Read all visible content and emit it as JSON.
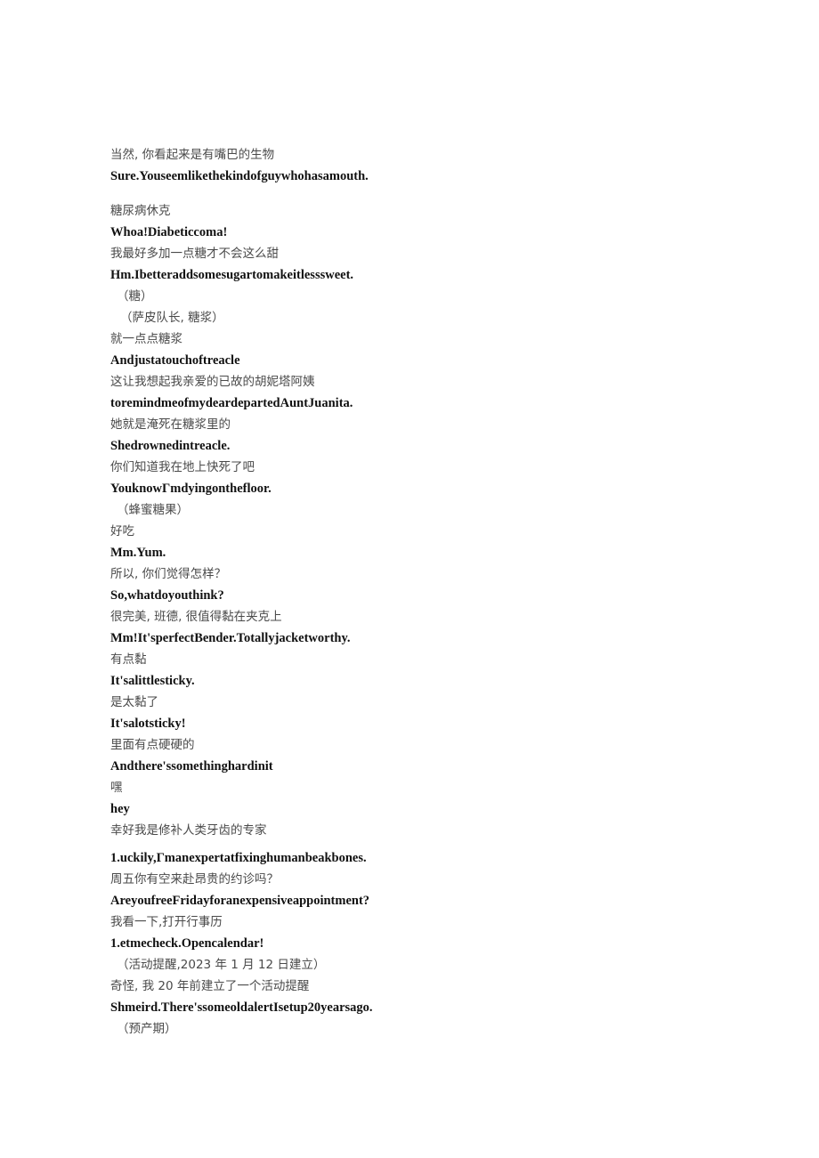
{
  "document": {
    "background_color": "#ffffff",
    "chinese_text_color": "#4a4a4a",
    "english_text_color": "#111111",
    "lines": [
      {
        "text": "当然, 你看起来是有嘴巴的生物",
        "lang": "zh",
        "style": ""
      },
      {
        "text": "Sure.Youseemlikethekindofguywhohasamouth.",
        "lang": "en",
        "style": ""
      },
      {
        "text": "糖尿病休克",
        "lang": "zh",
        "style": "gap-before"
      },
      {
        "text": "Whoa!Diabeticcoma!",
        "lang": "en",
        "style": ""
      },
      {
        "text": "我最好多加一点糖才不会这么甜",
        "lang": "zh",
        "style": ""
      },
      {
        "text": "Hm.Ibetteraddsomesugartomakeitlesssweet.",
        "lang": "en",
        "style": ""
      },
      {
        "text": "（糖）",
        "lang": "zh",
        "style": "paren"
      },
      {
        "text": "（萨皮队长, 糖浆）",
        "lang": "zh",
        "style": "paren-deep"
      },
      {
        "text": "就一点点糖浆",
        "lang": "zh",
        "style": ""
      },
      {
        "text": "Andjustatouchoftreacle",
        "lang": "en",
        "style": ""
      },
      {
        "text": "这让我想起我亲爱的已故的胡妮塔阿姨",
        "lang": "zh",
        "style": ""
      },
      {
        "text": "toremindmeofmydeardepartedAuntJuanita.",
        "lang": "en",
        "style": ""
      },
      {
        "text": "她就是淹死在糖浆里的",
        "lang": "zh",
        "style": ""
      },
      {
        "text": "Shedrownedintreacle.",
        "lang": "en",
        "style": ""
      },
      {
        "text": "你们知道我在地上快死了吧",
        "lang": "zh",
        "style": ""
      },
      {
        "text": "YouknowΓmdyingonthefloor.",
        "lang": "en",
        "style": ""
      },
      {
        "text": "（蜂蜜糖果）",
        "lang": "zh",
        "style": "paren"
      },
      {
        "text": "好吃",
        "lang": "zh",
        "style": ""
      },
      {
        "text": "Mm.Yum.",
        "lang": "en",
        "style": ""
      },
      {
        "text": "所以, 你们觉得怎样？",
        "lang": "zh",
        "style": ""
      },
      {
        "text": "So,whatdoyouthink?",
        "lang": "en",
        "style": ""
      },
      {
        "text": "很完美, 班德, 很值得黏在夹克上",
        "lang": "zh",
        "style": ""
      },
      {
        "text": "Mm!It'sperfectBender.Totallyjacketworthy.",
        "lang": "en",
        "style": ""
      },
      {
        "text": "有点黏",
        "lang": "zh",
        "style": ""
      },
      {
        "text": "It'salittlesticky.",
        "lang": "en",
        "style": ""
      },
      {
        "text": "是太黏了",
        "lang": "zh",
        "style": ""
      },
      {
        "text": "It'salotsticky!",
        "lang": "en",
        "style": ""
      },
      {
        "text": "里面有点硬硬的",
        "lang": "zh",
        "style": ""
      },
      {
        "text": "Andthere'ssomethinghardinit",
        "lang": "en",
        "style": ""
      },
      {
        "text": "嘿",
        "lang": "zh",
        "style": ""
      },
      {
        "text": "hey",
        "lang": "en",
        "style": ""
      },
      {
        "text": "幸好我是修补人类牙齿的专家",
        "lang": "zh",
        "style": ""
      },
      {
        "text": "1.uckily,Γmanexpertatfixinghumanbeakbones.",
        "lang": "en",
        "style": "gap-small-before"
      },
      {
        "text": "周五你有空来赴昂贵的约诊吗？",
        "lang": "zh",
        "style": ""
      },
      {
        "text": "AreyoufreeFridayforanexpensiveappointment?",
        "lang": "en",
        "style": ""
      },
      {
        "text": "我看一下,打开行事历",
        "lang": "zh",
        "style": ""
      },
      {
        "text": "1.etmecheck.Opencalendar!",
        "lang": "en",
        "style": ""
      },
      {
        "text": "（活动提醒,2023 年 1 月 12 日建立）",
        "lang": "zh",
        "style": "paren"
      },
      {
        "text": "奇怪, 我 20 年前建立了一个活动提醒",
        "lang": "zh",
        "style": ""
      },
      {
        "text": "Shmeird.There'ssomeoldalertIsetup20yearsago.",
        "lang": "en",
        "style": ""
      },
      {
        "text": "（预产期）",
        "lang": "zh",
        "style": "paren"
      }
    ]
  }
}
